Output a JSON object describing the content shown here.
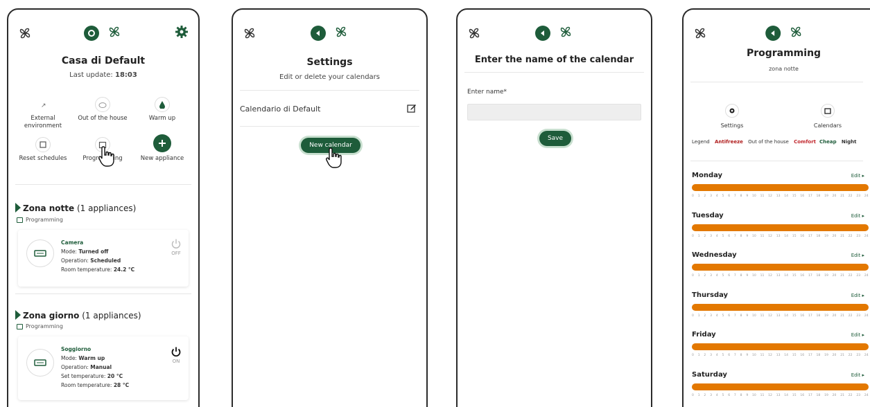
{
  "colors": {
    "brand": "#1e5c3a",
    "antifreeze": "#b01e1e",
    "comfort": "#c1272d",
    "bar": "#e37800"
  },
  "icons": [
    "fan-icon",
    "recycle-icon",
    "back-icon",
    "gear-icon",
    "edit-icon",
    "calendar-icon",
    "power-icon",
    "plus-icon",
    "drop-icon",
    "cloud-icon",
    "hand-cursor-icon"
  ],
  "p1": {
    "title": "Casa di Default",
    "last_update_label": "Last update:",
    "last_update_value": "18:03",
    "grid": [
      {
        "label": "External environment",
        "icon": "thermo-icon"
      },
      {
        "label": "Out of the house",
        "icon": "cloud-icon"
      },
      {
        "label": "Warm up",
        "icon": "drop-icon"
      },
      {
        "label": "Reset schedules",
        "icon": "reset-icon"
      },
      {
        "label": "Programming",
        "icon": "calendar-icon"
      },
      {
        "label": "New appliance",
        "icon": "plus-icon"
      }
    ],
    "zones": [
      {
        "name": "Zona notte",
        "count": "(1 appliances)",
        "programming": "Programming",
        "appliance": {
          "name": "Camera",
          "mode_label": "Mode:",
          "mode": "Turned off",
          "op_label": "Operation:",
          "op": "Scheduled",
          "room_label": "Room temperature:",
          "room": "24.2 °C",
          "power": "OFF"
        }
      },
      {
        "name": "Zona giorno",
        "count": "(1 appliances)",
        "programming": "Programming",
        "appliance": {
          "name": "Soggiorno",
          "mode_label": "Mode:",
          "mode": "Warm up",
          "op_label": "Operation:",
          "op": "Manual",
          "set_label": "Set temperature:",
          "set": "20 °C",
          "room_label": "Room temperature:",
          "room": "28 °C",
          "power": "ON"
        }
      }
    ]
  },
  "p2": {
    "title": "Settings",
    "subtitle": "Edit or delete your calendars",
    "calendar": "Calendario di Default",
    "new_button": "New calendar"
  },
  "p3": {
    "title": "Enter the name of the calendar",
    "field_label": "Enter name*",
    "field_value": "",
    "save_button": "Save"
  },
  "p4": {
    "title": "Programming",
    "subtitle": "zona notte",
    "settings_label": "Settings",
    "calendars_label": "Calendars",
    "legend": {
      "label": "Legend",
      "antifreeze": "Antifreeze",
      "out": "Out of the house",
      "comfort": "Comfort",
      "cheap": "Cheap",
      "night": "Night"
    },
    "edit_label": "Edit ▸",
    "hours": [
      "0",
      "1",
      "2",
      "3",
      "4",
      "5",
      "6",
      "7",
      "8",
      "9",
      "10",
      "11",
      "12",
      "13",
      "14",
      "15",
      "16",
      "17",
      "18",
      "19",
      "20",
      "21",
      "22",
      "23",
      "24"
    ],
    "days": [
      "Monday",
      "Tuesday",
      "Wednesday",
      "Thursday",
      "Friday",
      "Saturday"
    ]
  }
}
